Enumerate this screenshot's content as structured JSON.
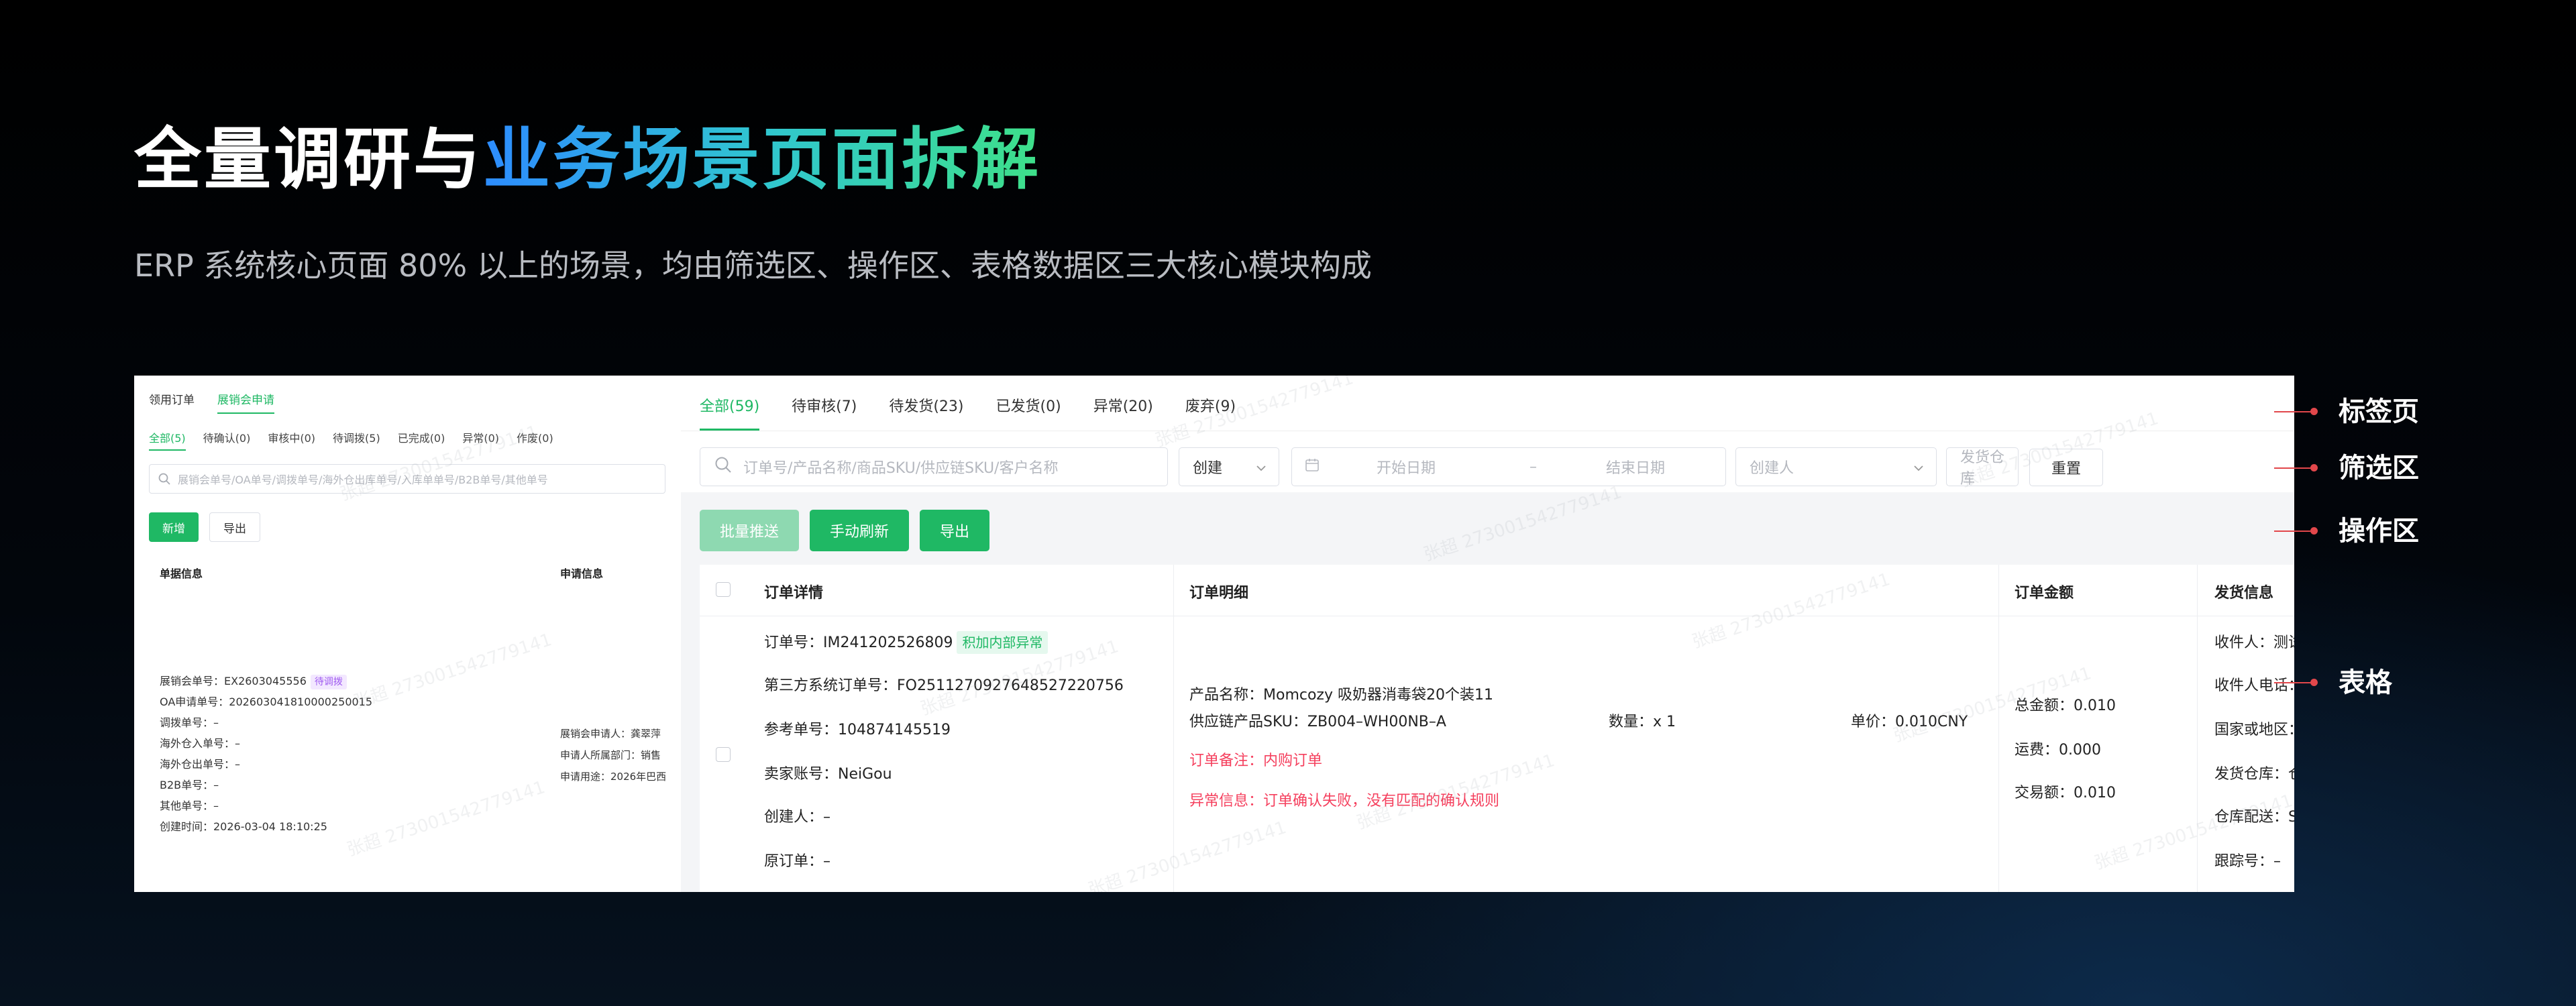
{
  "heading": {
    "title_white": "全量调研与",
    "title_accent": "业务场景页面拆解",
    "subtitle": "ERP 系统核心页面 80% 以上的场景，均由筛选区、操作区、表格数据区三大核心模块构成"
  },
  "left_panel": {
    "tabs": [
      "领用订单",
      "展销会申请"
    ],
    "subtabs": [
      "全部(5)",
      "待确认(0)",
      "审核中(0)",
      "待调拨(5)",
      "已完成(0)",
      "异常(0)",
      "作废(0)"
    ],
    "search_placeholder": "展销会单号/OA单号/调拨单号/海外仓出库单号/入库单单号/B2B单号/其他单号",
    "new_button": "新增",
    "export_button": "导出",
    "col_document_info": "单据信息",
    "col_application_info": "申请信息",
    "document": {
      "exhibition_no": "展销会单号：EX2603045556",
      "status_tag": "待调拨",
      "oa_no": "OA申请单号：20260304181000025001​5",
      "transfer_no": "调拨单号：–",
      "overseas_in": "海外仓入单号：–",
      "overseas_out": "海外仓出单号：–",
      "b2b_no": "B2B单号：–",
      "other_no": "其他单号：–",
      "created_at": "创建时间：2026-03-04 18:10:25"
    },
    "application": {
      "applicant": "展销会申请人：龚翠萍",
      "department": "申请人所属部门：销售",
      "purpose": "申请用途：2026年巴西"
    }
  },
  "right_panel": {
    "tabs": [
      "全部(59)",
      "待审核(7)",
      "待发货(23)",
      "已发货(0)",
      "异常(20)",
      "废弃(9)"
    ],
    "search_placeholder": "订单号/产品名称/商品SKU/供应链SKU/客户名称",
    "create_select": "创建",
    "start_date": "开始日期",
    "date_separator": "–",
    "end_date": "结束日期",
    "creator_placeholder": "创建人",
    "warehouse_placeholder": "发货仓库",
    "reset_button": "重置",
    "batch_push": "批量推送",
    "manual_refresh": "手动刷新",
    "export_button": "导出",
    "table": {
      "headers": [
        "订单详情",
        "订单明细",
        "订单金额",
        "发货信息"
      ],
      "order_no": "订单号：IM241202526809",
      "order_tag": "积加内部异常",
      "third_party_no": "第三方系统订单号：FO25112709276485272207​56",
      "ref_no": "参考单号：104874145519",
      "seller_account": "卖家账号：NeiGou",
      "creator": "创建人：–",
      "original_order": "原订单：–",
      "product_name": "产品名称：Momcozy 吸奶器消毒袋20个装11",
      "supply_sku": "供应链产品SKU：ZB004–WH00NB–A",
      "quantity": "数量：x 1",
      "unit_price": "单价：0.010CNY",
      "order_remark": "订单备注：内购订单",
      "exception_info": "异常信息：订单确认失败，没有匹配的确认规则",
      "total_amount": "总金额：0.010",
      "shipping_fee": "运费：0.000",
      "transaction_amount": "交易额：0.010",
      "recipient": "收件人：测试",
      "recipient_phone": "收件人电话：",
      "country_region": "国家或地区：",
      "ship_warehouse": "发货仓库：仓",
      "warehouse_delivery": "仓库配送：S",
      "tracking_no": "跟踪号：–"
    }
  },
  "watermark": "张超 2730015427791​41",
  "annotations": [
    "标签页",
    "筛选区",
    "操作区",
    "表格"
  ],
  "colors": {
    "brand_green": "#1fb864",
    "accent_blue": "#2d8cff",
    "accent_green": "#3ee089",
    "annotation_red": "#e2474b",
    "exception_red": "#f5405e"
  }
}
